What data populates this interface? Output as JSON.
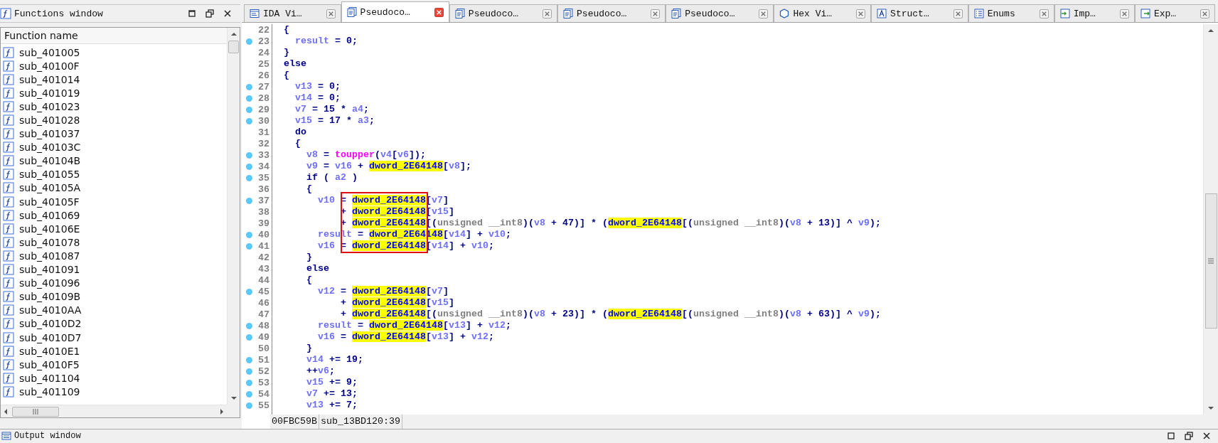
{
  "functions_window": {
    "title": "Functions window",
    "column": "Function name",
    "items": [
      "sub_401005",
      "sub_40100F",
      "sub_401014",
      "sub_401019",
      "sub_401023",
      "sub_401028",
      "sub_401037",
      "sub_40103C",
      "sub_40104B",
      "sub_401055",
      "sub_40105A",
      "sub_40105F",
      "sub_401069",
      "sub_40106E",
      "sub_401078",
      "sub_401087",
      "sub_401091",
      "sub_401096",
      "sub_40109B",
      "sub_4010AA",
      "sub_4010D2",
      "sub_4010D7",
      "sub_4010E1",
      "sub_4010F5",
      "sub_401104",
      "sub_401109"
    ]
  },
  "tabs": [
    {
      "label": "IDA Vi…",
      "kind": "disasm",
      "selected": false
    },
    {
      "label": "Pseudoco…",
      "kind": "pseudocode",
      "selected": true
    },
    {
      "label": "Pseudoco…",
      "kind": "pseudocode",
      "selected": false
    },
    {
      "label": "Pseudoco…",
      "kind": "pseudocode",
      "selected": false
    },
    {
      "label": "Pseudoco…",
      "kind": "pseudocode",
      "selected": false
    },
    {
      "label": "Hex Vi…",
      "kind": "hex",
      "selected": false
    },
    {
      "label": "Struct…",
      "kind": "struct",
      "selected": false
    },
    {
      "label": "Enums",
      "kind": "enum",
      "selected": false
    },
    {
      "label": "Imp…",
      "kind": "imports",
      "selected": false
    },
    {
      "label": "Exp…",
      "kind": "exports",
      "selected": false
    }
  ],
  "lines": [
    {
      "number": "22",
      "marker": false,
      "tokens": [
        {
          "kind": "plain",
          "text": "{"
        }
      ]
    },
    {
      "number": "23",
      "marker": true,
      "tokens": [
        {
          "kind": "var",
          "text": "  result"
        },
        {
          "kind": "plain",
          "text": " = 0;"
        }
      ]
    },
    {
      "number": "24",
      "marker": false,
      "tokens": [
        {
          "kind": "plain",
          "text": "}"
        }
      ]
    },
    {
      "number": "25",
      "marker": false,
      "tokens": [
        {
          "kind": "plain",
          "text": "else"
        }
      ]
    },
    {
      "number": "26",
      "marker": false,
      "tokens": [
        {
          "kind": "plain",
          "text": "{"
        }
      ]
    },
    {
      "number": "27",
      "marker": true,
      "tokens": [
        {
          "kind": "var",
          "text": "  v13"
        },
        {
          "kind": "plain",
          "text": " = 0;"
        }
      ]
    },
    {
      "number": "28",
      "marker": true,
      "tokens": [
        {
          "kind": "var",
          "text": "  v14"
        },
        {
          "kind": "plain",
          "text": " = 0;"
        }
      ]
    },
    {
      "number": "29",
      "marker": true,
      "tokens": [
        {
          "kind": "var",
          "text": "  v7"
        },
        {
          "kind": "plain",
          "text": " = 15 * "
        },
        {
          "kind": "var",
          "text": "a4"
        },
        {
          "kind": "plain",
          "text": ";"
        }
      ]
    },
    {
      "number": "30",
      "marker": true,
      "tokens": [
        {
          "kind": "var",
          "text": "  v15"
        },
        {
          "kind": "plain",
          "text": " = 17 * "
        },
        {
          "kind": "var",
          "text": "a3"
        },
        {
          "kind": "plain",
          "text": ";"
        }
      ]
    },
    {
      "number": "31",
      "marker": false,
      "tokens": [
        {
          "kind": "plain",
          "text": "  do"
        }
      ]
    },
    {
      "number": "32",
      "marker": false,
      "tokens": [
        {
          "kind": "plain",
          "text": "  {"
        }
      ]
    },
    {
      "number": "33",
      "marker": true,
      "tokens": [
        {
          "kind": "var",
          "text": "    v8"
        },
        {
          "kind": "plain",
          "text": " = "
        },
        {
          "kind": "func",
          "text": "toupper"
        },
        {
          "kind": "plain",
          "text": "("
        },
        {
          "kind": "var",
          "text": "v4"
        },
        {
          "kind": "plain",
          "text": "["
        },
        {
          "kind": "var",
          "text": "v6"
        },
        {
          "kind": "plain",
          "text": "]);"
        }
      ]
    },
    {
      "number": "34",
      "marker": true,
      "tokens": [
        {
          "kind": "var",
          "text": "    v9"
        },
        {
          "kind": "plain",
          "text": " = "
        },
        {
          "kind": "var",
          "text": "v16"
        },
        {
          "kind": "plain",
          "text": " + "
        },
        {
          "kind": "global",
          "text": "dword_2E64148"
        },
        {
          "kind": "plain",
          "text": "["
        },
        {
          "kind": "var",
          "text": "v8"
        },
        {
          "kind": "plain",
          "text": "];"
        }
      ]
    },
    {
      "number": "35",
      "marker": true,
      "tokens": [
        {
          "kind": "plain",
          "text": "    if ( "
        },
        {
          "kind": "var",
          "text": "a2"
        },
        {
          "kind": "plain",
          "text": " )"
        }
      ]
    },
    {
      "number": "36",
      "marker": false,
      "tokens": [
        {
          "kind": "plain",
          "text": "    {"
        }
      ]
    },
    {
      "number": "37",
      "marker": true,
      "tokens": [
        {
          "kind": "var",
          "text": "      v10"
        },
        {
          "kind": "plain",
          "text": " = "
        },
        {
          "kind": "global",
          "text": "dword_2E64148"
        },
        {
          "kind": "plain",
          "text": "["
        },
        {
          "kind": "var",
          "text": "v7"
        },
        {
          "kind": "plain",
          "text": "]"
        }
      ]
    },
    {
      "number": "38",
      "marker": false,
      "tokens": [
        {
          "kind": "plain",
          "text": "          + "
        },
        {
          "kind": "global",
          "text": "dword_2E64148"
        },
        {
          "kind": "plain",
          "text": "["
        },
        {
          "kind": "var",
          "text": "v15"
        },
        {
          "kind": "plain",
          "text": "]"
        }
      ]
    },
    {
      "number": "39",
      "marker": false,
      "tokens": [
        {
          "kind": "plain",
          "text": "          + "
        },
        {
          "kind": "global",
          "text": "dword_2E64148"
        },
        {
          "kind": "plain",
          "text": "[("
        },
        {
          "kind": "type",
          "text": "unsigned __int8"
        },
        {
          "kind": "plain",
          "text": ")("
        },
        {
          "kind": "var",
          "text": "v8"
        },
        {
          "kind": "plain",
          "text": " + 47)] * ("
        },
        {
          "kind": "global",
          "text": "dword_2E64148"
        },
        {
          "kind": "plain",
          "text": "[("
        },
        {
          "kind": "type",
          "text": "unsigned __int8"
        },
        {
          "kind": "plain",
          "text": ")("
        },
        {
          "kind": "var",
          "text": "v8"
        },
        {
          "kind": "plain",
          "text": " + 13)] ^ "
        },
        {
          "kind": "var",
          "text": "v9"
        },
        {
          "kind": "plain",
          "text": ");"
        }
      ]
    },
    {
      "number": "40",
      "marker": true,
      "tokens": [
        {
          "kind": "var",
          "text": "      result"
        },
        {
          "kind": "plain",
          "text": " = "
        },
        {
          "kind": "global",
          "text": "dword_2E64148"
        },
        {
          "kind": "plain",
          "text": "["
        },
        {
          "kind": "var",
          "text": "v14"
        },
        {
          "kind": "plain",
          "text": "] + "
        },
        {
          "kind": "var",
          "text": "v10"
        },
        {
          "kind": "plain",
          "text": ";"
        }
      ]
    },
    {
      "number": "41",
      "marker": true,
      "tokens": [
        {
          "kind": "var",
          "text": "      v16"
        },
        {
          "kind": "plain",
          "text": " = "
        },
        {
          "kind": "global",
          "text": "dword_2E64148"
        },
        {
          "kind": "plain",
          "text": "["
        },
        {
          "kind": "var",
          "text": "v14"
        },
        {
          "kind": "plain",
          "text": "] + "
        },
        {
          "kind": "var",
          "text": "v10"
        },
        {
          "kind": "plain",
          "text": ";"
        }
      ]
    },
    {
      "number": "42",
      "marker": false,
      "tokens": [
        {
          "kind": "plain",
          "text": "    }"
        }
      ]
    },
    {
      "number": "43",
      "marker": false,
      "tokens": [
        {
          "kind": "plain",
          "text": "    else"
        }
      ]
    },
    {
      "number": "44",
      "marker": false,
      "tokens": [
        {
          "kind": "plain",
          "text": "    {"
        }
      ]
    },
    {
      "number": "45",
      "marker": true,
      "tokens": [
        {
          "kind": "var",
          "text": "      v12"
        },
        {
          "kind": "plain",
          "text": " = "
        },
        {
          "kind": "global",
          "text": "dword_2E64148"
        },
        {
          "kind": "plain",
          "text": "["
        },
        {
          "kind": "var",
          "text": "v7"
        },
        {
          "kind": "plain",
          "text": "]"
        }
      ]
    },
    {
      "number": "46",
      "marker": false,
      "tokens": [
        {
          "kind": "plain",
          "text": "          + "
        },
        {
          "kind": "global",
          "text": "dword_2E64148"
        },
        {
          "kind": "plain",
          "text": "["
        },
        {
          "kind": "var",
          "text": "v15"
        },
        {
          "kind": "plain",
          "text": "]"
        }
      ]
    },
    {
      "number": "47",
      "marker": false,
      "tokens": [
        {
          "kind": "plain",
          "text": "          + "
        },
        {
          "kind": "global",
          "text": "dword_2E64148"
        },
        {
          "kind": "plain",
          "text": "[("
        },
        {
          "kind": "type",
          "text": "unsigned __int8"
        },
        {
          "kind": "plain",
          "text": ")("
        },
        {
          "kind": "var",
          "text": "v8"
        },
        {
          "kind": "plain",
          "text": " + 23)] * ("
        },
        {
          "kind": "global",
          "text": "dword_2E64148"
        },
        {
          "kind": "plain",
          "text": "[("
        },
        {
          "kind": "type",
          "text": "unsigned __int8"
        },
        {
          "kind": "plain",
          "text": ")("
        },
        {
          "kind": "var",
          "text": "v8"
        },
        {
          "kind": "plain",
          "text": " + 63)] ^ "
        },
        {
          "kind": "var",
          "text": "v9"
        },
        {
          "kind": "plain",
          "text": ");"
        }
      ]
    },
    {
      "number": "48",
      "marker": true,
      "tokens": [
        {
          "kind": "var",
          "text": "      result"
        },
        {
          "kind": "plain",
          "text": " = "
        },
        {
          "kind": "global",
          "text": "dword_2E64148"
        },
        {
          "kind": "plain",
          "text": "["
        },
        {
          "kind": "var",
          "text": "v13"
        },
        {
          "kind": "plain",
          "text": "] + "
        },
        {
          "kind": "var",
          "text": "v12"
        },
        {
          "kind": "plain",
          "text": ";"
        }
      ]
    },
    {
      "number": "49",
      "marker": true,
      "tokens": [
        {
          "kind": "var",
          "text": "      v16"
        },
        {
          "kind": "plain",
          "text": " = "
        },
        {
          "kind": "global",
          "text": "dword_2E64148"
        },
        {
          "kind": "plain",
          "text": "["
        },
        {
          "kind": "var",
          "text": "v13"
        },
        {
          "kind": "plain",
          "text": "] + "
        },
        {
          "kind": "var",
          "text": "v12"
        },
        {
          "kind": "plain",
          "text": ";"
        }
      ]
    },
    {
      "number": "50",
      "marker": false,
      "tokens": [
        {
          "kind": "plain",
          "text": "    }"
        }
      ]
    },
    {
      "number": "51",
      "marker": true,
      "tokens": [
        {
          "kind": "var",
          "text": "    v14"
        },
        {
          "kind": "plain",
          "text": " += 19;"
        }
      ]
    },
    {
      "number": "52",
      "marker": true,
      "tokens": [
        {
          "kind": "plain",
          "text": "    ++"
        },
        {
          "kind": "var",
          "text": "v6"
        },
        {
          "kind": "plain",
          "text": ";"
        }
      ]
    },
    {
      "number": "53",
      "marker": true,
      "tokens": [
        {
          "kind": "var",
          "text": "    v15"
        },
        {
          "kind": "plain",
          "text": " += 9;"
        }
      ]
    },
    {
      "number": "54",
      "marker": true,
      "tokens": [
        {
          "kind": "var",
          "text": "    v7"
        },
        {
          "kind": "plain",
          "text": " += 13;"
        }
      ]
    },
    {
      "number": "55",
      "marker": true,
      "tokens": [
        {
          "kind": "var",
          "text": "    v13"
        },
        {
          "kind": "plain",
          "text": " += 7;"
        }
      ]
    }
  ],
  "status_bar": {
    "address": "00FBC59B",
    "location": "sub_13BD120:39"
  },
  "output_window": {
    "title": "Output window"
  }
}
